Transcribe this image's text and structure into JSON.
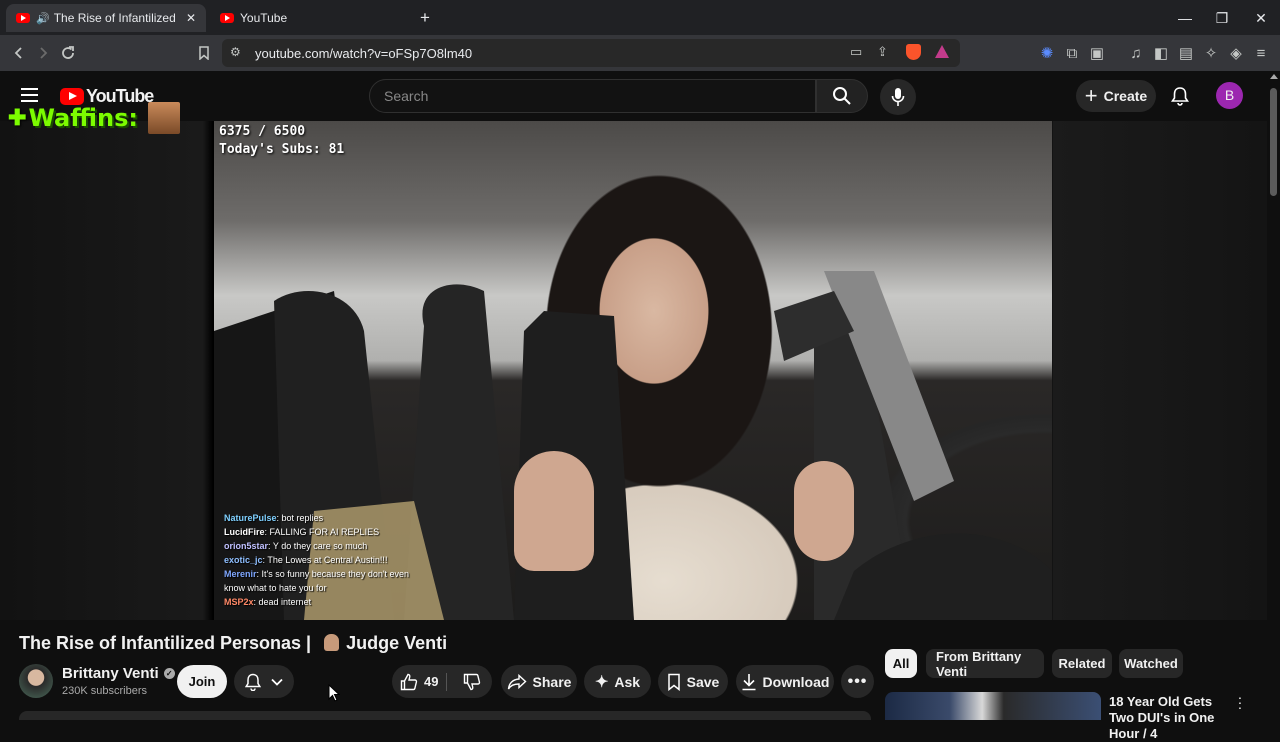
{
  "browser": {
    "tabs": [
      {
        "title": "The Rise of Infantilized Personas",
        "active": true
      },
      {
        "title": "YouTube",
        "active": false
      }
    ],
    "new_tab": "+",
    "window_controls": {
      "minimize": "—",
      "maximize": "❐",
      "close": "✕"
    },
    "url": "youtube.com/watch?v=oFSp7O8lm40"
  },
  "youtube": {
    "logo_text": "YouTube",
    "search_placeholder": "Search",
    "create_label": "Create",
    "avatar_letter": "B",
    "accent": "#ff0000",
    "avatar_color": "#9c27b0"
  },
  "stream_overlay": {
    "brand": "Waffins:",
    "counter": "6375 / 6500",
    "subs": "Today's Subs: 81",
    "chat": [
      {
        "user": "NaturePulse",
        "text": "bot replies",
        "color": "#7fd0ff"
      },
      {
        "user": "LucidFire",
        "text": "FALLING FOR AI REPLIES",
        "color": "#ffffff"
      },
      {
        "user": "orion5star",
        "text": "Y do they care so much",
        "color": "#c0c0ff"
      },
      {
        "user": "exotic_jc",
        "text": "The Lowes at Central Austin!!!",
        "color": "#8fbfff"
      },
      {
        "user": "Merenir",
        "text": "It's so funny because they don't even",
        "color": "#7fa7ff"
      },
      {
        "user": "",
        "text": "know what to hate you for",
        "color": "#ffffff"
      },
      {
        "user": "MSP2x",
        "text": "dead internet",
        "color": "#ff8866"
      }
    ]
  },
  "video": {
    "title": "The Rise of Infantilized Personas |",
    "title_suffix": "Judge Venti",
    "channel_name": "Brittany Venti",
    "subscribers": "230K subscribers",
    "join_label": "Join",
    "like_count": "49",
    "share_label": "Share",
    "ask_label": "Ask",
    "save_label": "Save",
    "download_label": "Download"
  },
  "sidebar": {
    "chips": [
      "All",
      "From Brittany Venti",
      "Related",
      "Watched"
    ],
    "recommendation_title": "18 Year Old Gets Two DUI's in One Hour / 4"
  }
}
